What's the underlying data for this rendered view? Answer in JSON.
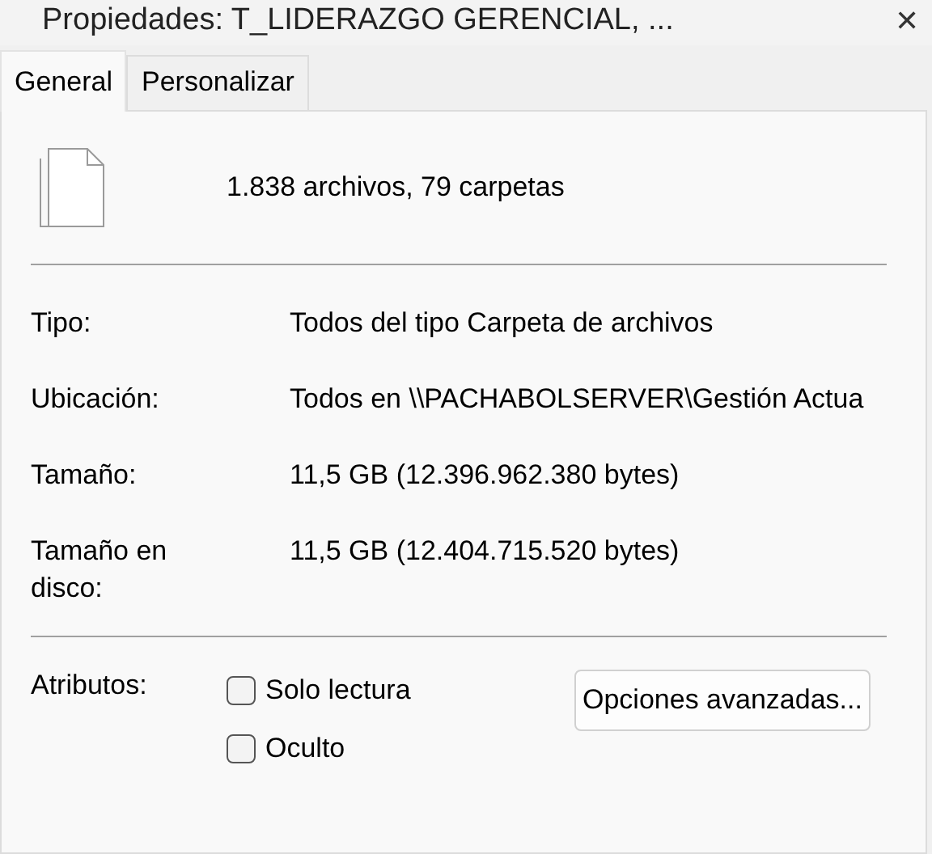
{
  "window": {
    "title": "Propiedades: T_LIDERAZGO GERENCIAL, ...",
    "close": "✕"
  },
  "tabs": [
    {
      "label": "General",
      "selected": true
    },
    {
      "label": "Personalizar",
      "selected": false
    }
  ],
  "summary": "1.838 archivos, 79 carpetas",
  "properties": [
    {
      "label": "Tipo:",
      "value": "Todos del tipo Carpeta de archivos"
    },
    {
      "label": "Ubicación:",
      "value": "Todos en \\\\PACHABOLSERVER\\Gestión Actua"
    },
    {
      "label": "Tamaño:",
      "value": "11,5 GB (12.396.962.380 bytes)"
    },
    {
      "label": "Tamaño en disco:",
      "value": "11,5 GB (12.404.715.520 bytes)"
    }
  ],
  "attributes": {
    "label": "Atributos:",
    "options": [
      {
        "label": "Solo lectura",
        "checked": false
      },
      {
        "label": "Oculto",
        "checked": false
      }
    ],
    "button": "Opciones avanzadas..."
  }
}
